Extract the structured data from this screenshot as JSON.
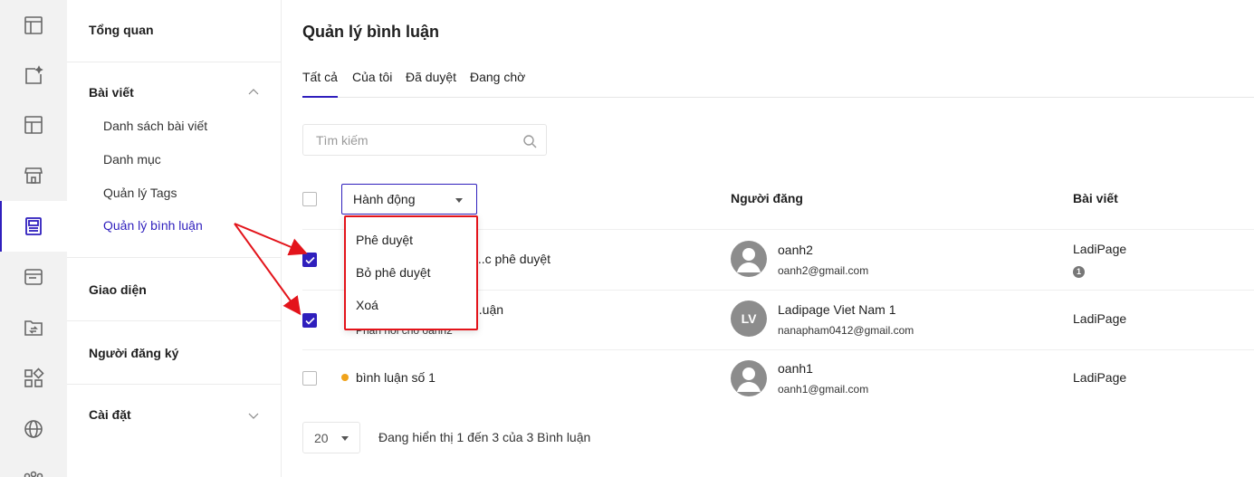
{
  "nav": {
    "overview": "Tổng quan",
    "posts": "Bài viết",
    "posts_items": [
      "Danh sách bài viết",
      "Danh mục",
      "Quản lý Tags",
      "Quản lý bình luận"
    ],
    "theme": "Giao diện",
    "subscribers": "Người đăng ký",
    "settings": "Cài đặt"
  },
  "rail_icons": [
    "dashboard-icon",
    "sparkle-post-icon",
    "layout-icon",
    "store-icon",
    "blog-icon",
    "browser-icon",
    "folder-sync-icon",
    "apps-icon",
    "globe-icon",
    "more-icon"
  ],
  "page": {
    "title": "Quản lý bình luận",
    "tabs": [
      "Tất cả",
      "Của tôi",
      "Đã duyệt",
      "Đang chờ"
    ],
    "active_tab": "Tất cả"
  },
  "search": {
    "placeholder": "Tìm kiếm"
  },
  "table": {
    "action_label": "Hành động",
    "columns": {
      "author": "Người đăng",
      "post": "Bài viết"
    },
    "rows": [
      {
        "comment": "...c phê duyệt",
        "comment_sub": "",
        "author_name": "oanh2",
        "author_email": "oanh2@gmail.com",
        "avatar": "default",
        "post": "LadiPage",
        "count": "1",
        "checked": true
      },
      {
        "comment": "...uận",
        "comment_sub": "Phản hồi cho oanh2",
        "author_name": "Ladipage Viet Nam 1",
        "author_email": "nanapham0412@gmail.com",
        "avatar": "LV",
        "post": "LadiPage",
        "count": "",
        "checked": true
      },
      {
        "comment": "bình luận số 1",
        "comment_sub": "",
        "author_name": "oanh1",
        "author_email": "oanh1@gmail.com",
        "avatar": "default",
        "post": "LadiPage",
        "count": "",
        "checked": false,
        "pending": true
      }
    ]
  },
  "dropdown": {
    "items": [
      "Phê duyệt",
      "Bỏ phê duyệt",
      "Xoá"
    ]
  },
  "pagination": {
    "page_size": "20",
    "info": "Đang hiển thị 1 đến 3 của 3 Bình luận"
  },
  "colors": {
    "accent": "#2f1fbd",
    "highlight": "#e3141b",
    "pending_dot": "#f0a31b"
  }
}
